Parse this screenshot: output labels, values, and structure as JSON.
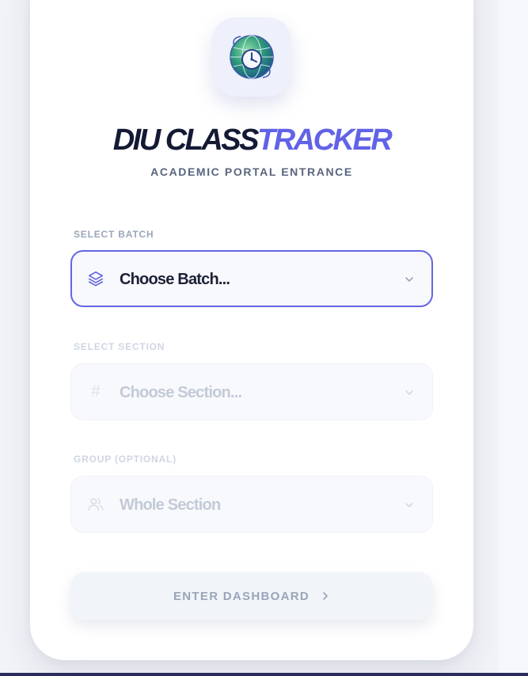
{
  "app": {
    "title_part1": "DIU CLASS",
    "title_part2": "TRACKER",
    "subtitle": "ACADEMIC PORTAL ENTRANCE"
  },
  "form": {
    "batch": {
      "label": "SELECT BATCH",
      "value": "Choose Batch...",
      "icon": "layers-icon",
      "state": "active"
    },
    "section": {
      "label": "SELECT SECTION",
      "value": "Choose Section...",
      "icon": "hash-icon",
      "state": "disabled"
    },
    "group": {
      "label": "GROUP (OPTIONAL)",
      "value": "Whole Section",
      "icon": "users-icon",
      "state": "disabled"
    }
  },
  "actions": {
    "enter_label": "ENTER DASHBOARD"
  },
  "colors": {
    "accent": "#6163e6",
    "title_dark": "#151a34",
    "muted": "#9ba6ba",
    "page_bg": "#f3f4f8"
  }
}
